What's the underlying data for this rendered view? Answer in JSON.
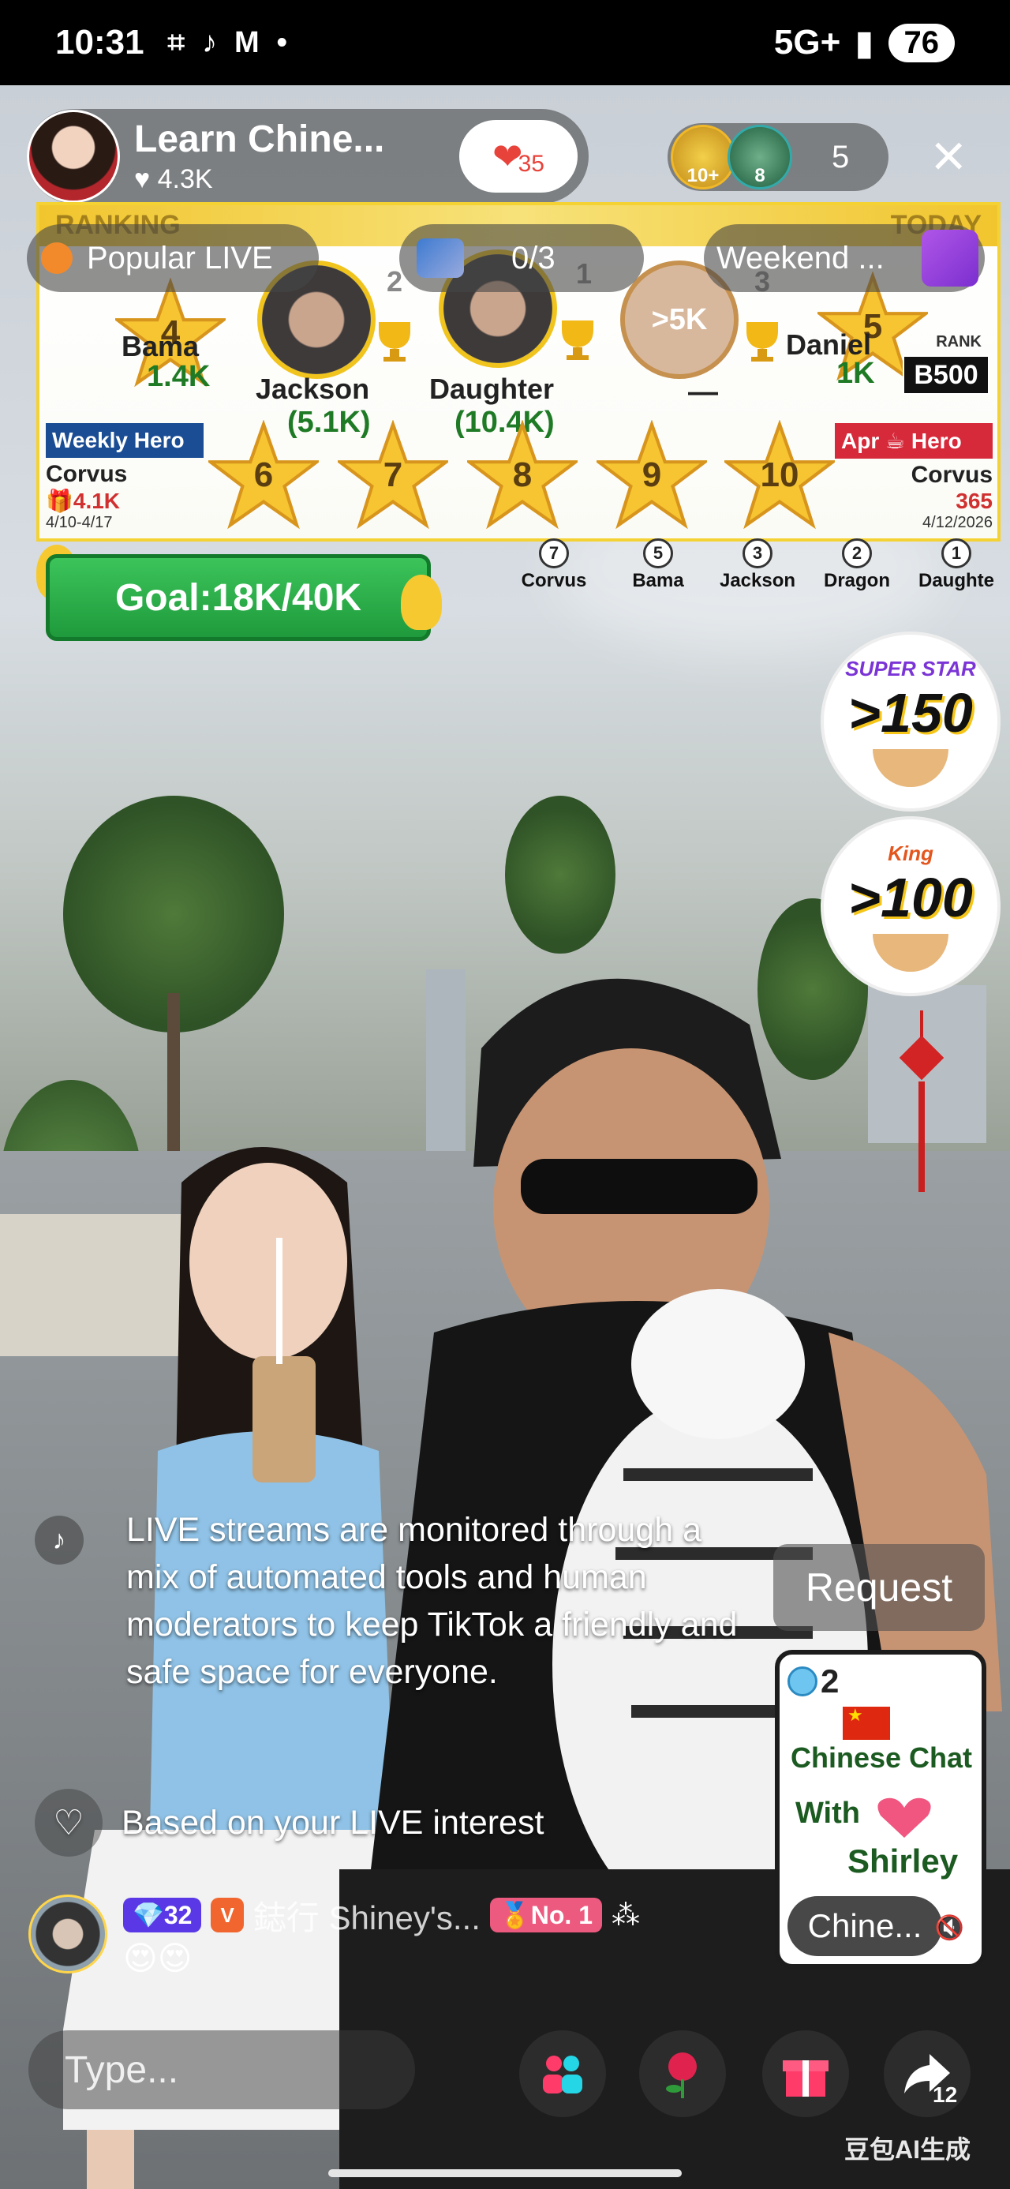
{
  "status_bar": {
    "time": "10:31",
    "network": "5G+",
    "battery": "76"
  },
  "host": {
    "name": "Learn Chine...",
    "likes": "4.3K",
    "heart_count": "35"
  },
  "viewers": {
    "avatar1_label": "10+",
    "avatar2_label": "8",
    "count": "5"
  },
  "ranking": {
    "label_left": "RANKING",
    "label_right": "TODAY",
    "top3": [
      {
        "rank": "2",
        "name": "Jackson",
        "value": "(5.1K)"
      },
      {
        "rank": "1",
        "name": "Daughter",
        "value": "(10.4K)"
      },
      {
        "rank": "3",
        "name": "",
        "value": "—",
        "circle": ">5K"
      }
    ],
    "star_4": {
      "rank": "4",
      "name": "Bama",
      "value": "1.4K"
    },
    "star_5": {
      "rank": "5",
      "name": "Daniel",
      "value": "1K"
    },
    "rank_badge_label": "RANK",
    "rank_badge": "B500",
    "stars": [
      "6",
      "7",
      "8",
      "9",
      "10"
    ],
    "weekly_hero": {
      "tag": "Weekly Hero",
      "name": "Corvus",
      "value": "4.1K",
      "dates": "4/10-4/17"
    },
    "apr_hero": {
      "tag": "Apr ☕ Hero",
      "name": "Corvus",
      "value": "365",
      "dates": "4/12/2026"
    }
  },
  "pills": {
    "popular": "Popular LIVE",
    "task": "0/3",
    "weekend": "Weekend ..."
  },
  "goal": "Goal:18K/40K",
  "contributors": [
    {
      "rank": "7",
      "name": "Corvus"
    },
    {
      "rank": "5",
      "name": "Bama"
    },
    {
      "rank": "3",
      "name": "Jackson"
    },
    {
      "rank": "2",
      "name": "Dragon"
    },
    {
      "rank": "1",
      "name": "Daughte"
    }
  ],
  "promos": [
    {
      "title": "SUPER STAR",
      "value": ">150"
    },
    {
      "title": "King",
      "value": ">100"
    }
  ],
  "notice": "LIVE streams are monitored through a mix of automated tools and human moderators to keep TikTok a friendly and safe space for everyone.",
  "interest": "Based on your LIVE interest",
  "comment": {
    "level": "32",
    "v_badge": "V",
    "user": "鋕行 Shiney's...",
    "rank_badge": "No. 1",
    "emoji": "😍😍"
  },
  "request": "Request",
  "chat_card": {
    "count": "2",
    "line1": "Chinese Chat",
    "line2": "With",
    "line3": "Shirley",
    "footer": "Chine..."
  },
  "input": {
    "placeholder": "Type..."
  },
  "share_count": "12",
  "watermark": "豆包AI生成",
  "colors": {
    "accent_green": "#1f9a3c",
    "ranking_gold": "#f5d234",
    "heart_red": "#e8433b"
  }
}
